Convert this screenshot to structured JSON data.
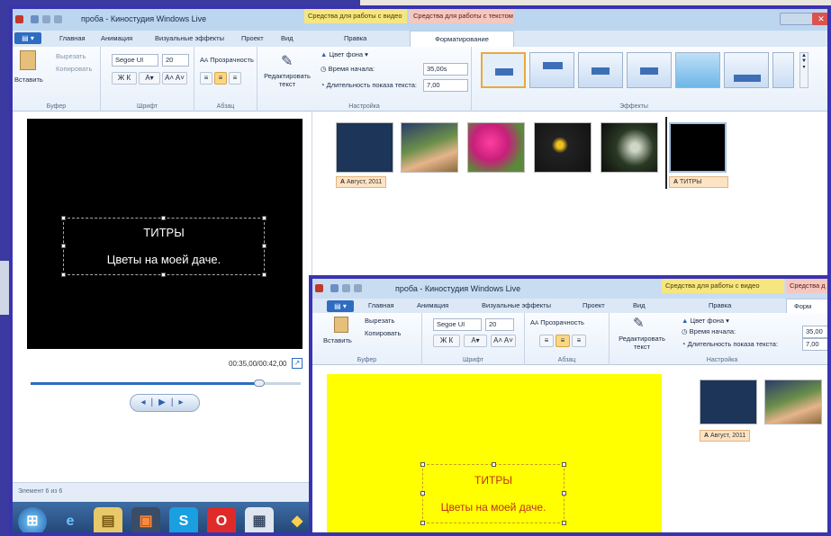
{
  "window": {
    "title": "проба - Киностудия Windows Live",
    "context_video": "Средства для работы с видео",
    "context_text": "Средства для работы с текстом",
    "context_text_short": "Средства д"
  },
  "tabs": [
    "Главная",
    "Анимация",
    "Визуальные эффекты",
    "Проект",
    "Вид",
    "Правка",
    "Форматирование"
  ],
  "tabs2_last": "Форм",
  "ribbon": {
    "paste": "Вставить",
    "cut": "Вырезать",
    "copy": "Копировать",
    "font_name": "Segoe UI",
    "font_size": "20",
    "transparency": "Прозрачность",
    "edit_text": "Редактировать текст",
    "bg_color": "Цвет фона",
    "start_time_label": "Время начала:",
    "start_time_value": "35,00s",
    "start_time_value2": "35,00",
    "duration_label": "Длительность показа текста:",
    "duration_value": "7,00",
    "groups": {
      "clipboard": "Буфер",
      "font": "Шрифт",
      "paragraph": "Абзац",
      "settings": "Настройка",
      "effects": "Эффекты"
    }
  },
  "preview": {
    "title": "ТИТРЫ",
    "subtitle": "Цветы на моей даче.",
    "timecode": "00:35,00/00:42,00"
  },
  "status": "Элемент 6 из 6",
  "storyboard": {
    "caption1": "Август, 2011",
    "caption2": "ТИТРЫ"
  },
  "colors": {
    "accent": "#3a33b0",
    "preview_bg2": "#ffff00",
    "title_text2": "#c03020"
  }
}
